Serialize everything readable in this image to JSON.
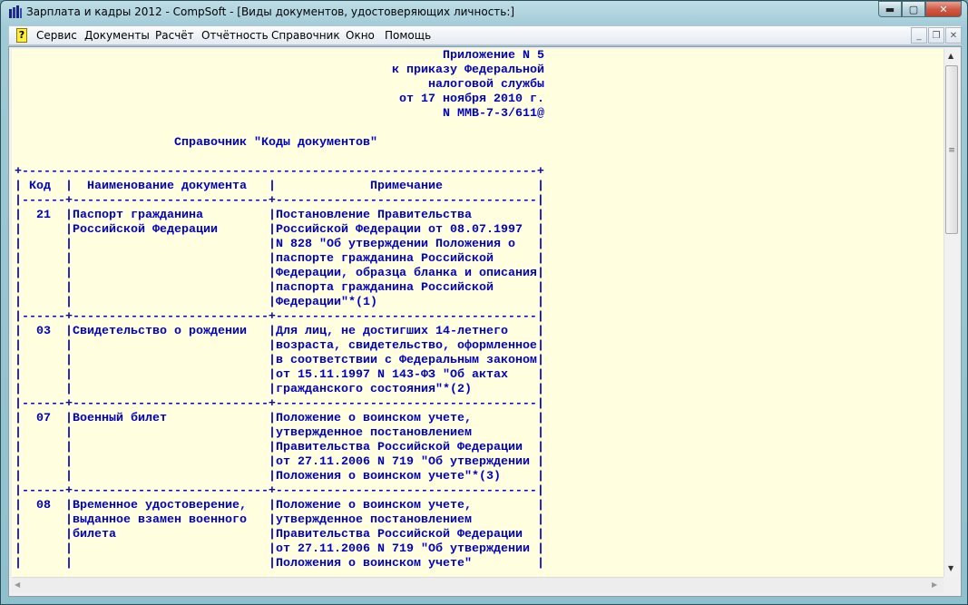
{
  "window": {
    "title": "Зарплата и кадры 2012 - CompSoft - [Виды документов, удостоверяющих личность:]"
  },
  "menu": {
    "help_icon": "?",
    "items": [
      "Сервис",
      "Документы",
      "Расчёт",
      "Отчётность",
      "Справочник",
      "Окно",
      "Помощь"
    ]
  },
  "document": {
    "header_lines": [
      "Приложение N 5",
      "к приказу Федеральной",
      "налоговой службы",
      "от 17 ноября 2010 г.",
      "N ММВ-7-3/611@"
    ],
    "title": "Справочник \"Коды документов\"",
    "columns": [
      "Код",
      "Наименование документа",
      "Примечание"
    ],
    "rows": [
      {
        "code": "21",
        "name": [
          "Паспорт гражданина",
          "Российской Федерации"
        ],
        "note": [
          "Постановление Правительства",
          "Российской Федерации от 08.07.1997",
          "N 828 \"Об утверждении Положения о",
          "паспорте гражданина Российской",
          "Федерации, образца бланка и описания",
          "паспорта гражданина Российской",
          "Федерации\"*(1)"
        ]
      },
      {
        "code": "03",
        "name": [
          "Свидетельство о рождении"
        ],
        "note": [
          "Для лиц, не достигших 14-летнего",
          "возраста, свидетельство, оформленное",
          "в соответствии с Федеральным законом",
          "от 15.11.1997 N 143-ФЗ \"Об актах",
          "гражданского состояния\"*(2)"
        ]
      },
      {
        "code": "07",
        "name": [
          "Военный билет"
        ],
        "note": [
          "Положение о воинском учете,",
          "утвержденное постановлением",
          "Правительства Российской Федерации",
          "от 27.11.2006 N 719 \"Об утверждении",
          "Положения о воинском учете\"*(3)"
        ]
      },
      {
        "code": "08",
        "name": [
          "Временное удостоверение,",
          "выданное взамен военного",
          "билета"
        ],
        "note": [
          "Положение о воинском учете,",
          "утвержденное постановлением",
          "Правительства Российской Федерации",
          "от 27.11.2006 N 719 \"Об утверждении",
          "Положения о воинском учете\""
        ]
      }
    ]
  }
}
